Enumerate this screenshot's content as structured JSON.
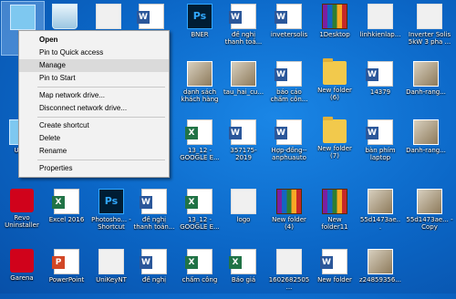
{
  "context_menu": {
    "items": [
      "Open",
      "Pin to Quick access",
      "Manage",
      "Pin to Start"
    ],
    "items_b": [
      "Map network drive...",
      "Disconnect network drive..."
    ],
    "items_c": [
      "Create shortcut",
      "Delete",
      "Rename"
    ],
    "items_d": [
      "Properties"
    ]
  },
  "desktop": {
    "row1": [
      "Th",
      "",
      "",
      "",
      "BNER",
      "đề nghị thanh toá...",
      "invetersolis",
      "1Desktop",
      "linhkienlap...",
      "Inverter Solis 5kW 3 pha ..."
    ],
    "row2": [
      "dạnh sách khách hàng",
      "tau_hai_cu...",
      "báo cáo chấm côn...",
      "New folder (6)",
      "14379",
      "Danh-rang..."
    ],
    "row3": [
      "Ultra",
      "13_12 - GOOGLE E...",
      "357175-2019",
      "Hợp-đồng--anphuauto",
      "New folder (7)",
      "bàn phím laptop",
      "Danh-rang..."
    ],
    "row4": [
      "Revo Uninstaller",
      "Excel 2016",
      "Photosho... - Shortcut",
      "đề nghị thanh toán...",
      "13_12 - GOOGLE E...",
      "logo",
      "New folder (4)",
      "New folder11",
      "55d1473ae...",
      "55d1473ae... - Copy"
    ],
    "row5": [
      "Garena",
      "PowerPoint",
      "UniKeyNT",
      "đề nghị",
      "chấm công",
      "Báo giá",
      "1602682505...",
      "New folder",
      "z24859356..."
    ]
  }
}
